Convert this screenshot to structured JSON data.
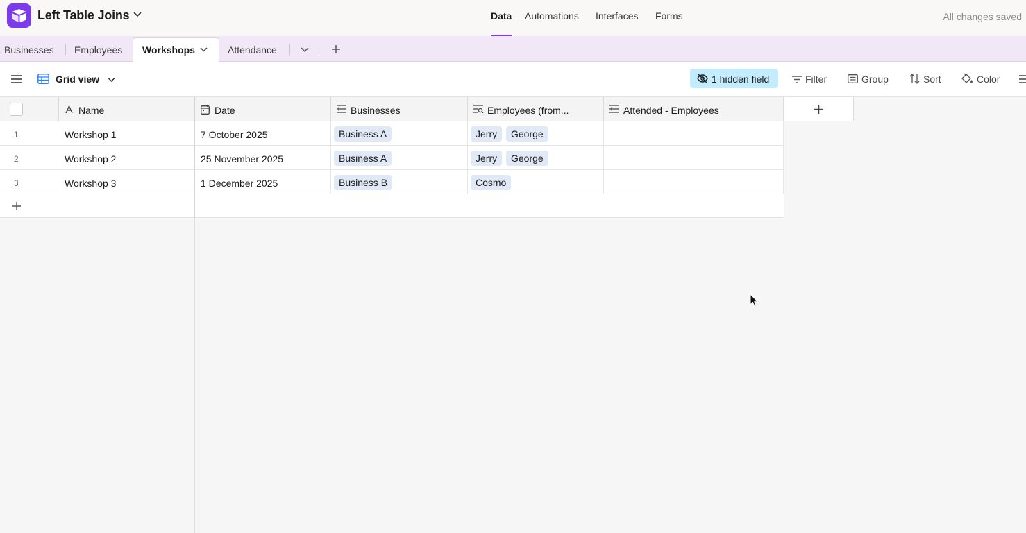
{
  "app": {
    "base_title": "Left Table Joins",
    "nav": [
      {
        "label": "Data",
        "active": true
      },
      {
        "label": "Automations",
        "active": false
      },
      {
        "label": "Interfaces",
        "active": false
      },
      {
        "label": "Forms",
        "active": false
      }
    ],
    "save_status": "All changes saved",
    "accent_color": "#7c3aed"
  },
  "tables": {
    "tabs": [
      "Businesses",
      "Employees",
      "Workshops",
      "Attendance"
    ],
    "active": "Workshops"
  },
  "view": {
    "name": "Grid view",
    "hidden_fields": "1 hidden field",
    "toolbar": [
      "Filter",
      "Group",
      "Sort",
      "Color"
    ]
  },
  "grid": {
    "columns": [
      {
        "label": "Name",
        "icon": "text-icon"
      },
      {
        "label": "Date",
        "icon": "calendar-icon"
      },
      {
        "label": "Businesses",
        "icon": "linked-record-icon"
      },
      {
        "label": "Employees (from...",
        "icon": "lookup-icon"
      },
      {
        "label": "Attended - Employees",
        "icon": "linked-record-icon"
      }
    ],
    "rows": [
      {
        "num": "1",
        "name": "Workshop 1",
        "date": "7 October 2025",
        "businesses": [
          "Business A"
        ],
        "employees": [
          "Jerry",
          "George"
        ],
        "attended": []
      },
      {
        "num": "2",
        "name": "Workshop 2",
        "date": "25 November 2025",
        "businesses": [
          "Business A"
        ],
        "employees": [
          "Jerry",
          "George"
        ],
        "attended": []
      },
      {
        "num": "3",
        "name": "Workshop 3",
        "date": "1 December 2025",
        "businesses": [
          "Business B"
        ],
        "employees": [
          "Cosmo"
        ],
        "attended": []
      }
    ]
  }
}
